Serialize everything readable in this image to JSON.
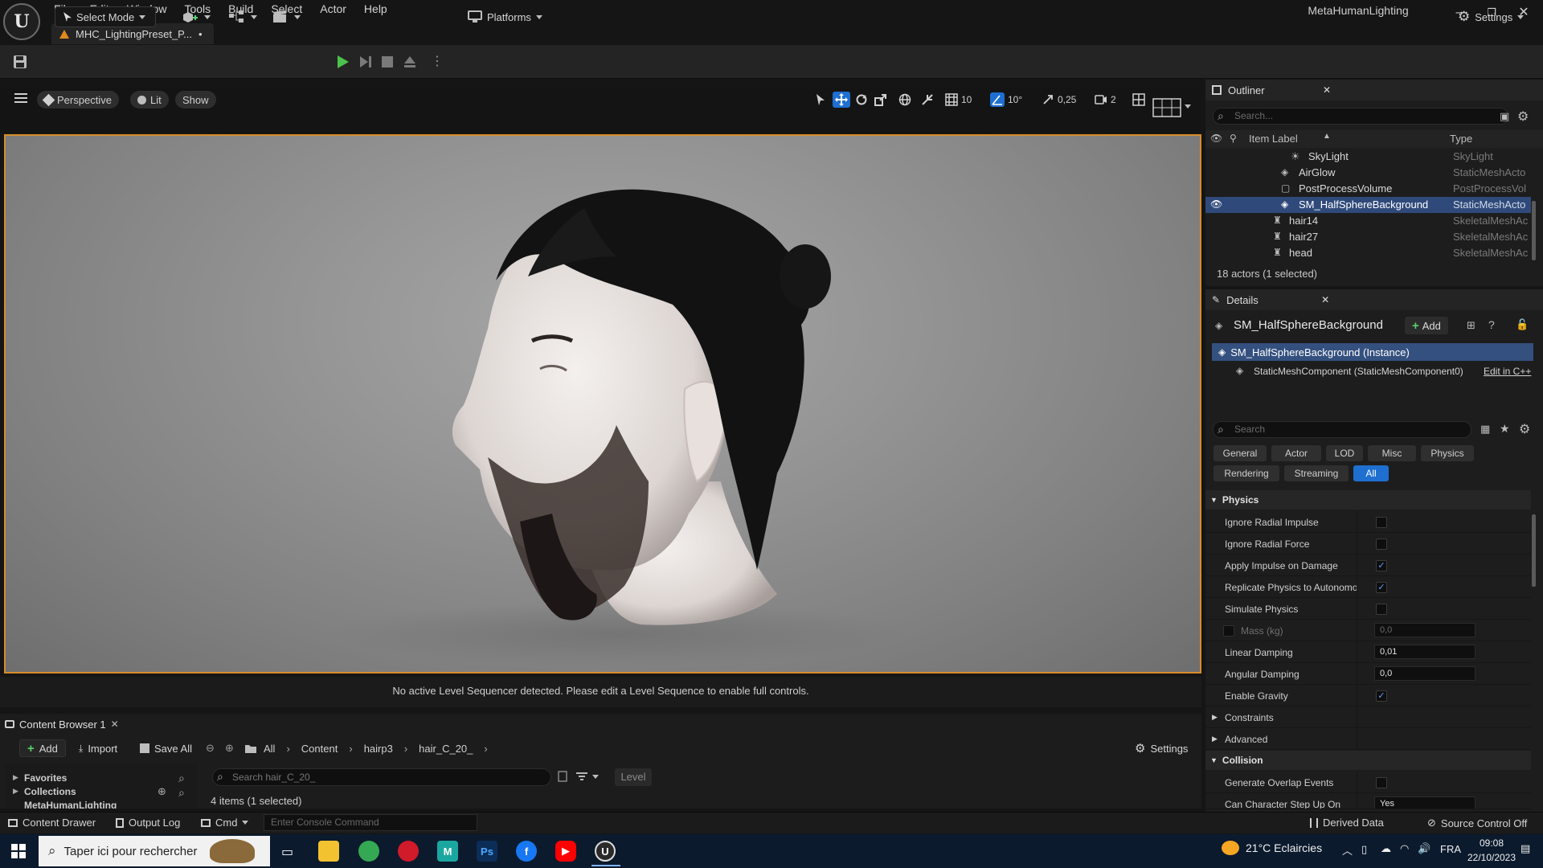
{
  "menu": {
    "items": [
      "File",
      "Edit",
      "Window",
      "Tools",
      "Build",
      "Select",
      "Actor",
      "Help"
    ],
    "project_name": "MetaHumanLighting",
    "doc_tab": "MHC_LightingPreset_P...",
    "doc_tab_modified": "•"
  },
  "toolbar": {
    "select_mode": "Select Mode",
    "platforms": "Platforms",
    "settings": "Settings"
  },
  "viewport": {
    "perspective": "Perspective",
    "lit": "Lit",
    "show": "Show",
    "grid_snap": "10",
    "rotation_snap": "10°",
    "scale_snap": "0,25",
    "camera_speed": "2",
    "sequencer_message": "No active Level Sequencer detected. Please edit a Level Sequence to enable full controls."
  },
  "content_browser": {
    "tab_title": "Content Browser 1",
    "add": "Add",
    "import": "Import",
    "save_all": "Save All",
    "breadcrumbs": [
      "All",
      "Content",
      "hairp3",
      "hair_C_20_"
    ],
    "settings": "Settings",
    "search_placeholder": "Search hair_C_20_",
    "level_filter": "Level",
    "tree": [
      "Favorites",
      "Collections",
      "MetaHumanLighting"
    ],
    "item_count": "4 items (1 selected)"
  },
  "statusbar": {
    "content_drawer": "Content Drawer",
    "output_log": "Output Log",
    "cmd": "Cmd",
    "console_placeholder": "Enter Console Command",
    "derived_data": "Derived Data",
    "source_control": "Source Control Off"
  },
  "outliner": {
    "title": "Outliner",
    "search_placeholder": "Search...",
    "col_label": "Item Label",
    "col_type": "Type",
    "rows": [
      {
        "name": "SkyLight",
        "type": "SkyLight"
      },
      {
        "name": "AirGlow",
        "type": "StaticMeshActo"
      },
      {
        "name": "PostProcessVolume",
        "type": "PostProcessVol"
      },
      {
        "name": "SM_HalfSphereBackground",
        "type": "StaticMeshActo"
      },
      {
        "name": "hair14",
        "type": "SkeletalMeshAc"
      },
      {
        "name": "hair27",
        "type": "SkeletalMeshAc"
      },
      {
        "name": "head",
        "type": "SkeletalMeshAc"
      }
    ],
    "footer": "18 actors (1 selected)"
  },
  "details": {
    "title": "Details",
    "actor_name": "SM_HalfSphereBackground",
    "add": "Add",
    "instance": "SM_HalfSphereBackground (Instance)",
    "component": "StaticMeshComponent (StaticMeshComponent0)",
    "edit_cpp": "Edit in C++",
    "search_placeholder": "Search",
    "filters_row1": [
      "General",
      "Actor",
      "LOD",
      "Misc",
      "Physics"
    ],
    "filters_row2": [
      "Rendering",
      "Streaming",
      "All"
    ],
    "physics_category": "Physics",
    "props": {
      "ignore_radial_impulse": "Ignore Radial Impulse",
      "ignore_radial_force": "Ignore Radial Force",
      "apply_impulse": "Apply Impulse on Damage",
      "replicate_physics": "Replicate Physics to Autonomou...",
      "simulate_physics": "Simulate Physics",
      "mass": "Mass (kg)",
      "mass_value": "0,0",
      "linear_damping": "Linear Damping",
      "linear_damping_value": "0,01",
      "angular_damping": "Angular Damping",
      "angular_damping_value": "0,0",
      "enable_gravity": "Enable Gravity"
    },
    "constraints": "Constraints",
    "advanced": "Advanced",
    "collision_category": "Collision",
    "generate_overlap": "Generate Overlap Events",
    "can_step_up": "Can Character Step Up On",
    "can_step_up_value": "Yes"
  },
  "taskbar": {
    "search_placeholder": "Taper ici pour rechercher",
    "weather": "21°C  Eclaircies",
    "language": "FRA",
    "time": "09:08",
    "date": "22/10/2023"
  }
}
